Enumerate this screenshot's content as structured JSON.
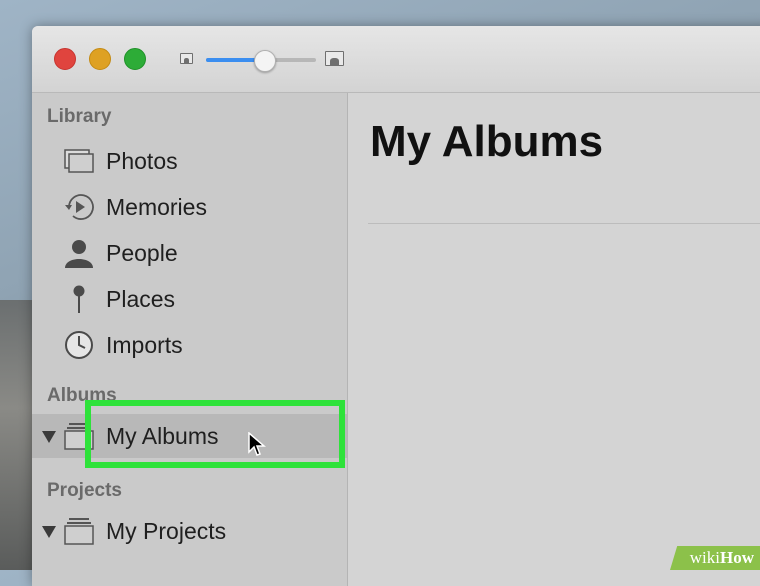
{
  "window": {
    "controls": [
      "close",
      "minimize",
      "maximize"
    ],
    "zoom_slider": {
      "value": 0.53,
      "accent": "#3b8ef0"
    }
  },
  "sidebar": {
    "library_header": "Library",
    "library_items": [
      {
        "label": "Photos",
        "icon": "photos-icon"
      },
      {
        "label": "Memories",
        "icon": "memories-icon"
      },
      {
        "label": "People",
        "icon": "people-icon"
      },
      {
        "label": "Places",
        "icon": "places-icon"
      },
      {
        "label": "Imports",
        "icon": "imports-icon"
      }
    ],
    "albums_header": "Albums",
    "albums_item": {
      "label": "My Albums",
      "icon": "album-stack-icon",
      "selected": true
    },
    "projects_header": "Projects",
    "projects_item": {
      "label": "My Projects",
      "icon": "project-stack-icon"
    }
  },
  "main": {
    "title": "My Albums"
  },
  "annotation": {
    "highlight_color": "#2ee23a"
  },
  "watermark": {
    "part1": "wiki",
    "part2": "How",
    "color": "#8cc14a"
  }
}
